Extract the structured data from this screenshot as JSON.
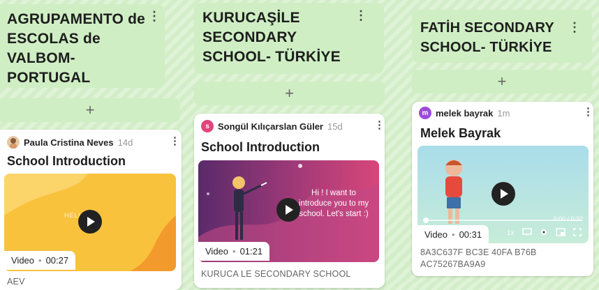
{
  "columns": [
    {
      "title": "AGRUPAMENTO de ESCOLAS de VALBOM-PORTUGAL",
      "add": "+",
      "card": {
        "author": "Paula Cristina Neves",
        "age": "14d",
        "title": "School Introduction",
        "media_type": "Video",
        "duration": "00:27",
        "thumb_text": "HELLO",
        "caption": "AEV"
      }
    },
    {
      "title": "KURUCAŞİLE SECONDARY SCHOOL- TÜRKİYE",
      "add": "+",
      "card": {
        "author": "Songül Kılıçarslan Güler",
        "age": "15d",
        "title": "School Introduction",
        "media_type": "Video",
        "duration": "01:21",
        "thumb_text": "Hi ! I want to introduce you to my school. Let's start :)",
        "caption": "KURUCA LE SECONDARY SCHOOL"
      }
    },
    {
      "title": "FATİH SECONDARY SCHOOL- TÜRKİYE",
      "add": "+",
      "card": {
        "author": "melek bayrak",
        "age": "1m",
        "avatar_letter": "m",
        "title": "Melek Bayrak",
        "media_type": "Video",
        "duration": "00:31",
        "time_display": "0:00 / 0:32",
        "speed": "1x",
        "caption_line1": "8A3C637F BC3E 40FA B76B",
        "caption_line2": "AC75267BA9A9"
      }
    }
  ],
  "colors": {
    "background": "#dff3d6",
    "header": "#cfeec4",
    "avatar_songul": "#e0457b",
    "avatar_melek": "#9c4ad9"
  }
}
